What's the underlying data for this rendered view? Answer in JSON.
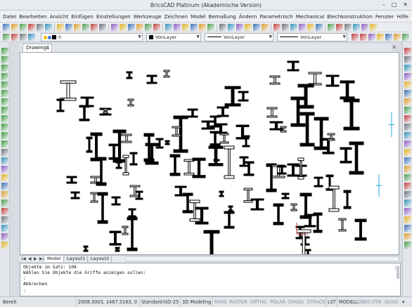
{
  "window": {
    "title": "BricsCAD Platinum (Akademische Version)",
    "controls": [
      "–",
      "□",
      "✕"
    ]
  },
  "menu": [
    "Datei",
    "Bearbeiten",
    "Ansicht",
    "Einfügen",
    "Einstellungen",
    "Werkzeuge",
    "Zeichnen",
    "Model",
    "Bemaßung",
    "Ändern",
    "Parametrisch",
    "Mechanical",
    "Blechkonstruktion",
    "Fenster",
    "Hilfe"
  ],
  "properties": {
    "layer": "0",
    "color": "VonLayer",
    "linetype": "VonLayer",
    "lineweight": "VonLayer"
  },
  "document": {
    "tab": "Drawing1",
    "close": "✕"
  },
  "layout_tabs": [
    "Model",
    "Layout1",
    "Layout2"
  ],
  "command_history": [
    "Objekte im Satz: 108",
    "Wählen Sie Objekte die Griffe anzeigen sollen:",
    ":",
    "Abbrechen"
  ],
  "command_prompt": ":",
  "status": {
    "ready": "Bereit",
    "coordinates": "2008.3003, 1467.5163, 0",
    "textstyle": "Standard",
    "dimstyle": "ISO-25",
    "workspace": "3D Modeling",
    "toggles_off": [
      "FANG",
      "RASTER",
      "ORTHO",
      "POLAR",
      "OFANG",
      "OTRACK"
    ],
    "toggles_on": [
      "LST",
      "MODELL"
    ],
    "toggles_right": [
      "DBKS",
      "DYN",
      "QUAD"
    ]
  }
}
